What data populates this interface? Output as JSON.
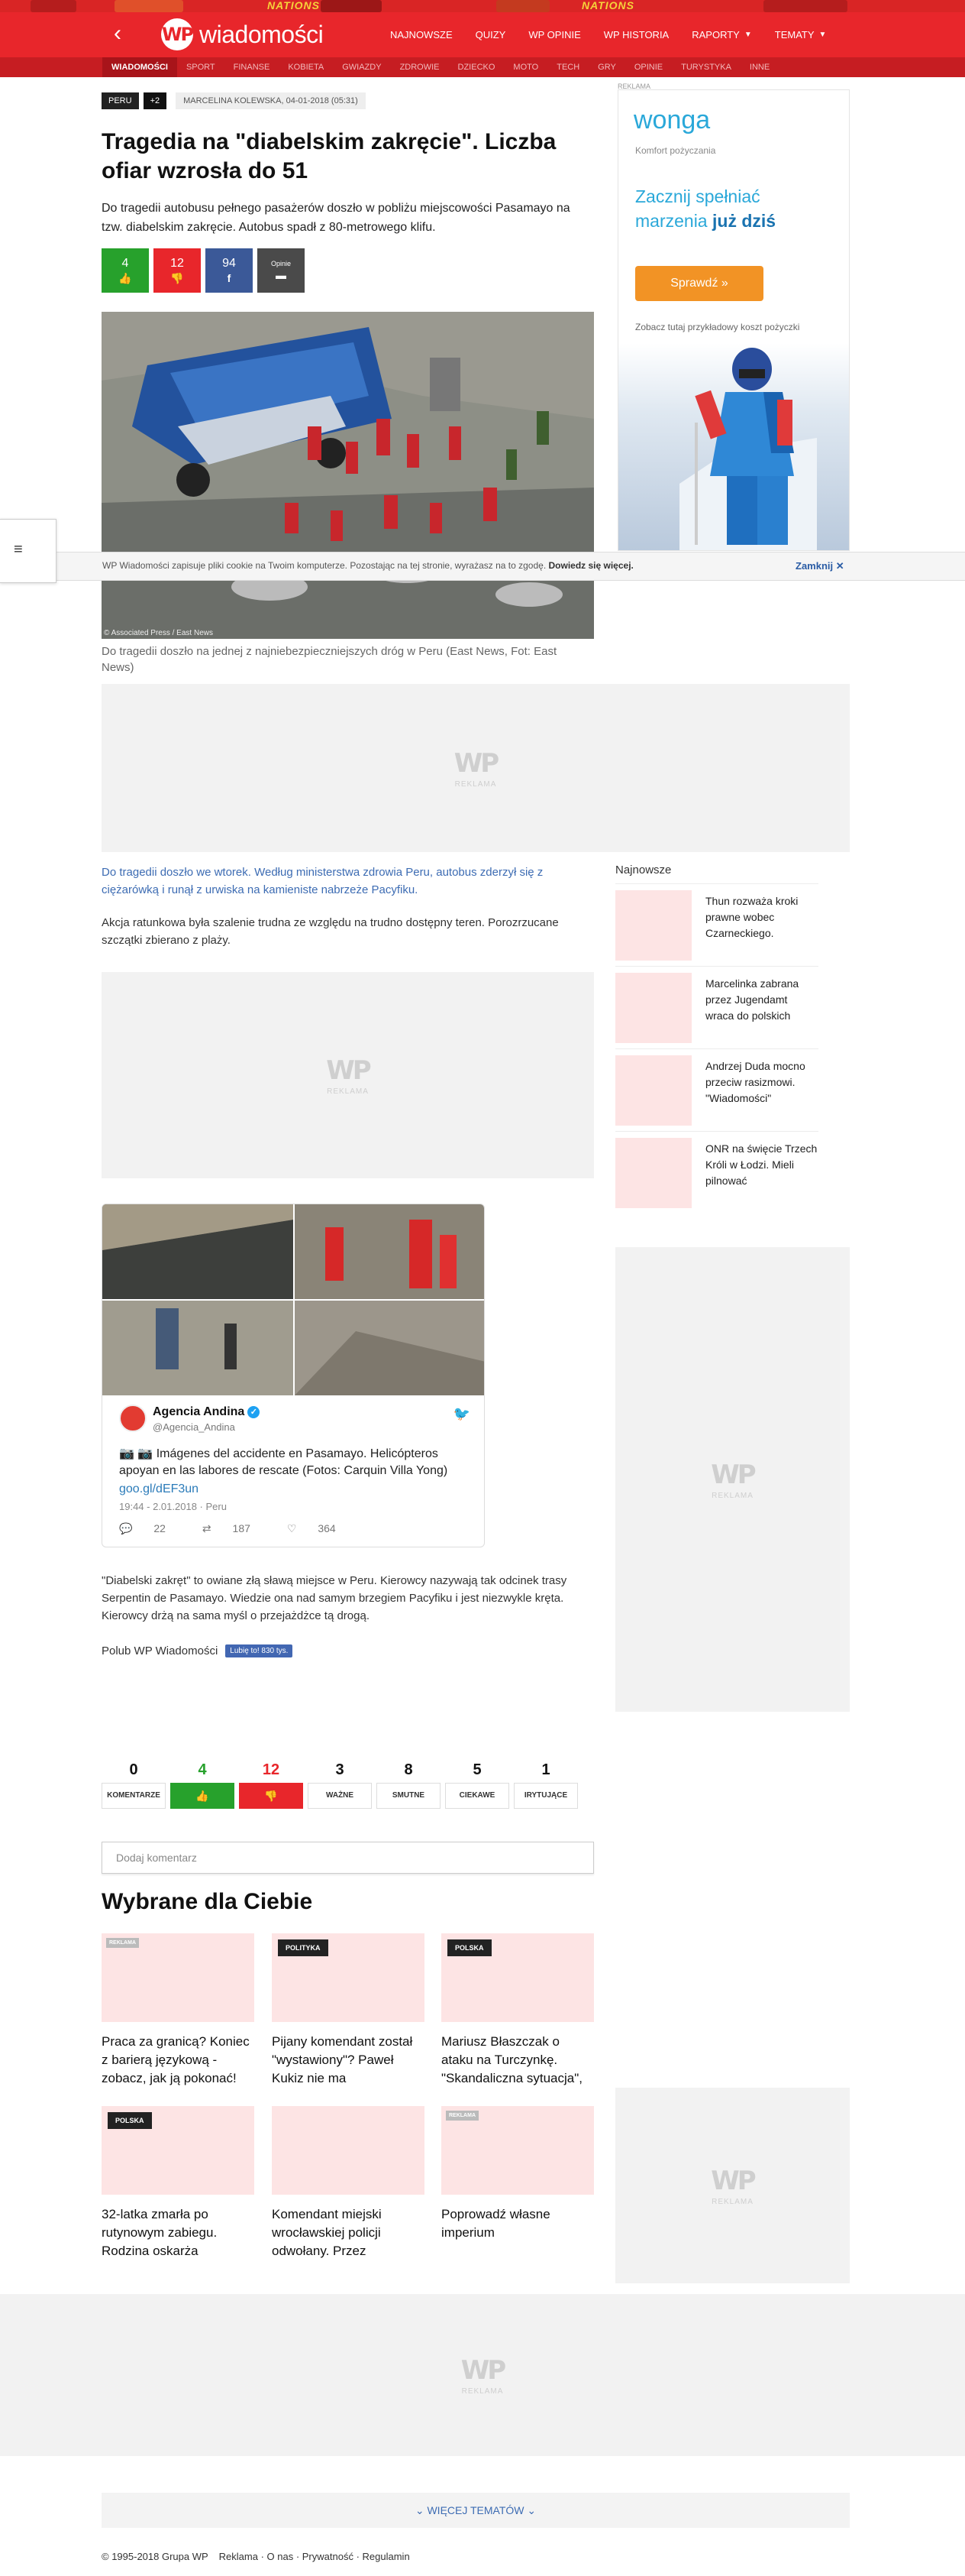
{
  "header": {
    "strip_text": "NATIONS",
    "logo_mark": "WP",
    "site_name": "wiadomości",
    "nav": [
      "NAJNOWSZE",
      "QUIZY",
      "WP OPINIE",
      "WP HISTORIA",
      "RAPORTY",
      "TEMATY"
    ]
  },
  "subnav": [
    "WIADOMOŚCI",
    "SPORT",
    "FINANSE",
    "KOBIETA",
    "GWIAZDY",
    "ZDROWIE",
    "DZIECKO",
    "MOTO",
    "TECH",
    "GRY",
    "OPINIE",
    "TURYSTYKA",
    "INNE"
  ],
  "article": {
    "tag": "PERU",
    "tag_more": "+2",
    "author": "MARCELINA KOLEWSKA, 04-01-2018 (05:31)",
    "title": "Tragedia na \"diabelskim zakręcie\". Liczba ofiar wzrosła do 51",
    "lead": "Do tragedii autobusu pełnego pasażerów doszło w pobliżu miejscowości Pasamayo na tzw. diabelskim zakręcie. Autobus spadł z 80-metrowego klifu.",
    "share": {
      "up": "4",
      "down": "12",
      "fb": "94",
      "opinion": "Opinie"
    },
    "image_credit": "© Associated Press / East News",
    "caption": "Do tragedii doszło na jednej z najniebezpieczniejszych dróg w Peru (East News, Fot: East News)",
    "p1": "Do tragedii doszło we wtorek. Według ministerstwa zdrowia Peru, autobus zderzył się z ciężarówką i runął z urwiska na kamieniste nabrzeże Pacyfiku.",
    "p2": "Akcja ratunkowa była szalenie trudna ze względu na trudno dostępny teren. Porozrzucane szczątki zbierano z plaży.",
    "p3": "\"Diabelski zakręt\" to owiane złą sławą miejsce w Peru. Kierowcy nazywają tak odcinek trasy Serpentin de Pasamayo. Wiedzie ona nad samym brzegiem Pacyfiku i jest niezwykle kręta. Kierowcy drżą na sama myśl o przejażdżce tą drogą.",
    "like_wp": "Polub WP Wiadomości",
    "fb_like": "Lubię to! 830 tys."
  },
  "cookie": {
    "text": "WP Wiadomości zapisuje pliki cookie na Twoim komputerze. Pozostając na tej stronie, wyrażasz na to zgodę.",
    "link": "Dowiedz się więcej.",
    "close": "Zamknij"
  },
  "ads": {
    "label": "REKLAMA",
    "mark": "WP",
    "sub": "REKLAMA"
  },
  "wonga": {
    "brand": "wonga",
    "tagline": "Komfort pożyczania",
    "headline1": "Zacznij spełniać",
    "headline2": "marzenia",
    "headline_bold": "już dziś",
    "cta": "Sprawdź »",
    "note": "Zobacz tutaj przykładowy koszt pożyczki"
  },
  "tweet": {
    "name": "Agencia Andina",
    "handle": "@Agencia_Andina",
    "text": "📷 📷 Imágenes del accidente en Pasamayo. Helicópteros apoyan en las labores de rescate (Fotos: Carquin Villa Yong)",
    "link": "goo.gl/dEF3un",
    "time": "19:44 - 2.01.2018 · Peru",
    "replies": "22",
    "retweets": "187",
    "likes": "364"
  },
  "najnowsze": {
    "title": "Najnowsze",
    "items": [
      "Thun rozważa kroki prawne wobec Czarneckiego.",
      "Marcelinka zabrana przez Jugendamt wraca do polskich",
      "Andrzej Duda mocno przeciw rasizmowi. \"Wiadomości\"",
      "ONR na święcie Trzech Króli w Łodzi. Mieli pilnować"
    ]
  },
  "reactions": [
    {
      "n": "0",
      "label": "KOMENTARZE",
      "kind": "plain"
    },
    {
      "n": "4",
      "label": "👍",
      "kind": "up"
    },
    {
      "n": "12",
      "label": "👎",
      "kind": "down"
    },
    {
      "n": "3",
      "label": "WAŻNE",
      "kind": "plain"
    },
    {
      "n": "8",
      "label": "SMUTNE",
      "kind": "plain"
    },
    {
      "n": "5",
      "label": "CIEKAWE",
      "kind": "plain"
    },
    {
      "n": "1",
      "label": "IRYTUJĄCE",
      "kind": "plain"
    }
  ],
  "comment_placeholder": "Dodaj komentarz",
  "wybrane": {
    "title": "Wybrane dla Ciebie",
    "cards": [
      {
        "label": "REKLAMA",
        "title": "Praca za granicą? Koniec z barierą językową - zobacz, jak ją pokonać!"
      },
      {
        "label": "POLITYKA",
        "title": "Pijany komendant został \"wystawiony\"? Paweł Kukiz nie ma"
      },
      {
        "label": "POLSKA",
        "title": "Mariusz Błaszczak o ataku na Turczynkę. \"Skandaliczna sytuacja\","
      },
      {
        "label": "POLSKA",
        "title": "32-latka zmarła po rutynowym zabiegu. Rodzina oskarża"
      },
      {
        "label": "",
        "title": "Komendant miejski wrocławskiej policji odwołany. Przez"
      },
      {
        "label": "REKLAMA",
        "title": "Poprowadź własne imperium"
      }
    ]
  },
  "more_topics": "WIĘCEJ TEMATÓW",
  "footer": [
    "© 1995-2018 Grupa WP",
    "Reklama",
    "O nas",
    "Prywatność",
    "Regulamin"
  ],
  "colors": {
    "brand_red": "#e8262b",
    "up_green": "#27a12c",
    "fb_blue": "#3b5998",
    "link_blue": "#3d6cb3"
  }
}
